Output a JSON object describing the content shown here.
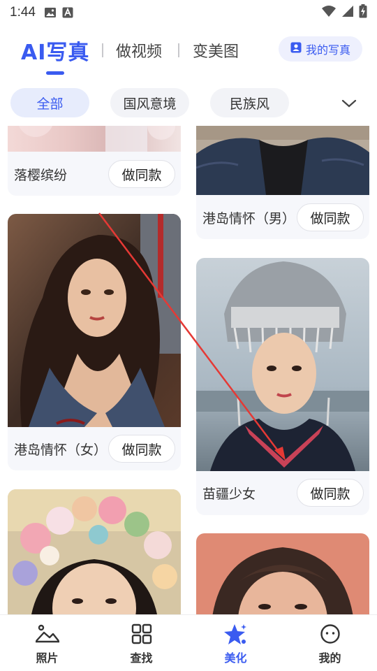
{
  "status_bar": {
    "time": "1:44",
    "icons": [
      "gallery-icon",
      "a-icon",
      "wifi-icon",
      "signal-icon",
      "battery-charging-icon"
    ]
  },
  "header": {
    "tabs": [
      {
        "label": "AI写真",
        "active": true
      },
      {
        "label": "做视频",
        "active": false
      },
      {
        "label": "变美图",
        "active": false
      }
    ],
    "my_photo_label": "我的写真",
    "accent_color": "#3a5bf0"
  },
  "filters": {
    "chips": [
      {
        "label": "全部",
        "active": true
      },
      {
        "label": "国风意境",
        "active": false
      },
      {
        "label": "民族风",
        "active": false
      }
    ],
    "more_icon": "chevron-down-icon"
  },
  "cards": [
    {
      "title": "落樱缤纷",
      "button": "做同款"
    },
    {
      "title": "港岛情怀（男）",
      "button": "做同款"
    },
    {
      "title": "港岛情怀（女）",
      "button": "做同款"
    },
    {
      "title": "苗疆少女",
      "button": "做同款"
    },
    {
      "title": "",
      "button": ""
    },
    {
      "title": "",
      "button": ""
    }
  ],
  "bottom_nav": [
    {
      "label": "照片",
      "icon": "landscape-icon",
      "active": false
    },
    {
      "label": "查找",
      "icon": "grid-icon",
      "active": false
    },
    {
      "label": "美化",
      "icon": "star-sparkle-icon",
      "active": true
    },
    {
      "label": "我的",
      "icon": "face-icon",
      "active": false
    }
  ]
}
